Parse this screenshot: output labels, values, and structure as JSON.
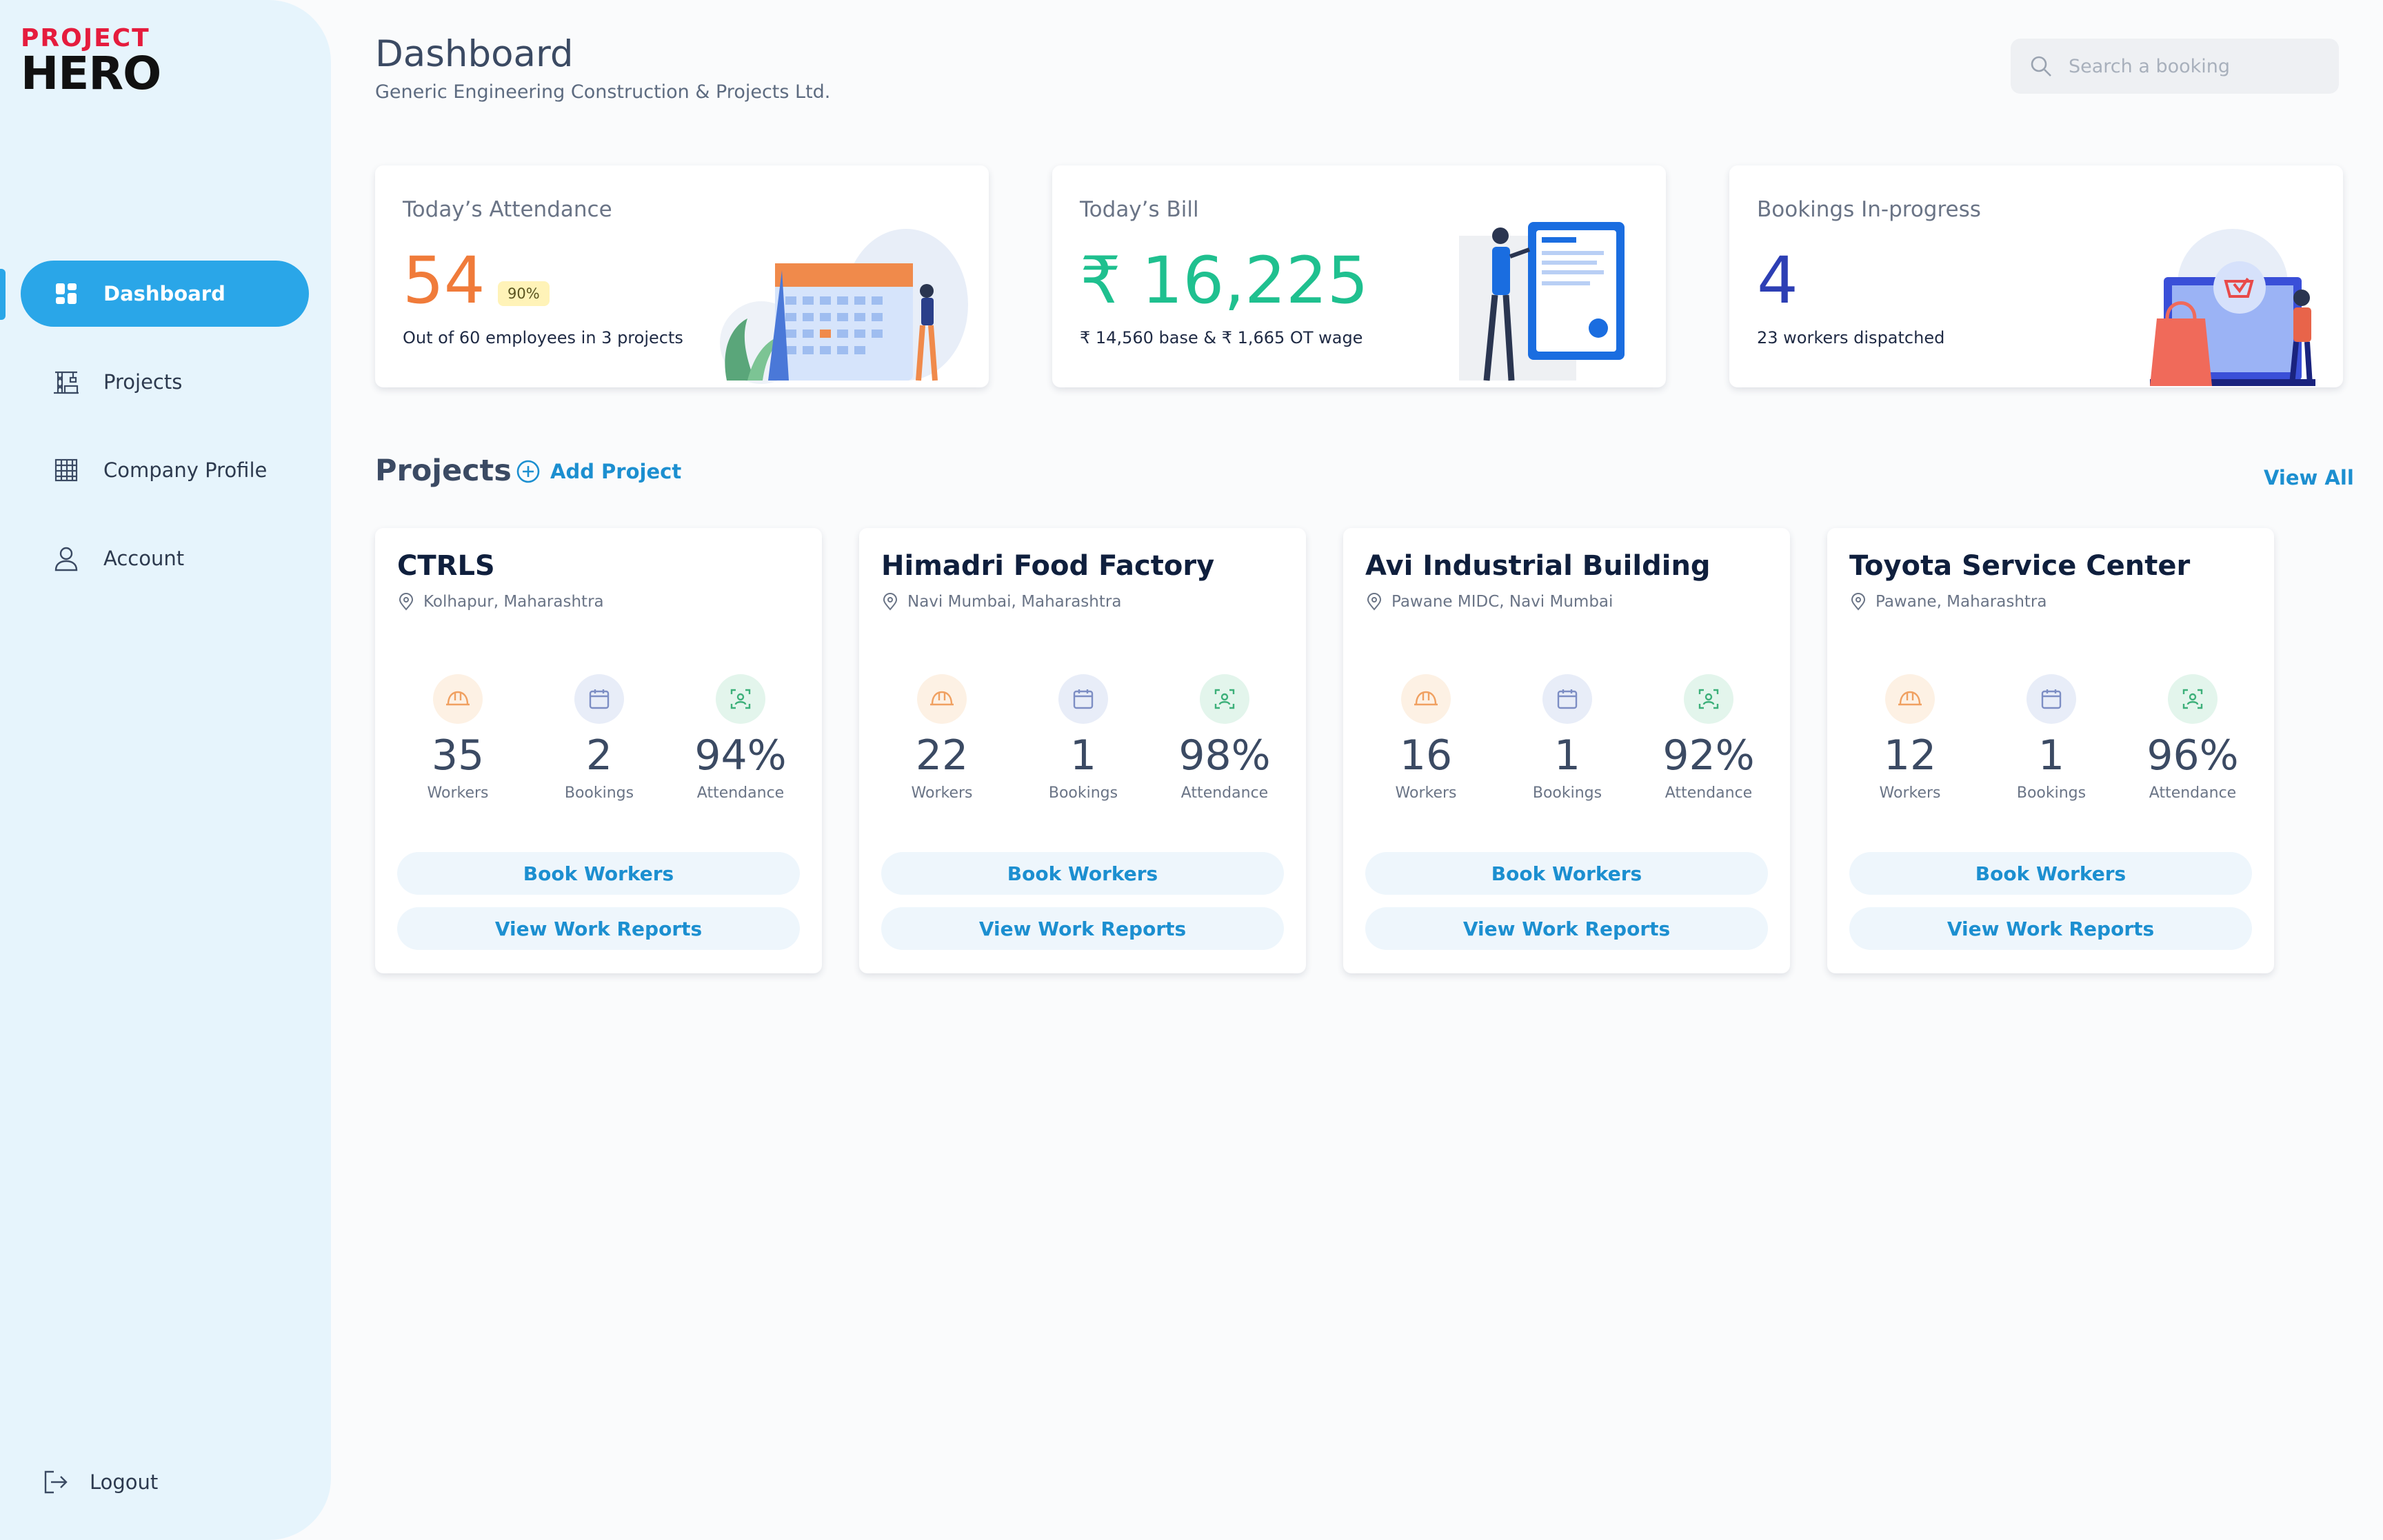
{
  "logo": {
    "line1": "PROJECT",
    "line2": "HERO"
  },
  "sidebar": {
    "items": [
      {
        "label": "Dashboard",
        "icon": "dashboard-grid-icon",
        "active": true
      },
      {
        "label": "Projects",
        "icon": "crane-icon",
        "active": false
      },
      {
        "label": "Company Profile",
        "icon": "building-icon",
        "active": false
      },
      {
        "label": "Account",
        "icon": "user-icon",
        "active": false
      }
    ],
    "logout": "Logout"
  },
  "header": {
    "title": "Dashboard",
    "subtitle": "Generic Engineering Construction & Projects Ltd.",
    "search_placeholder": "Search a booking"
  },
  "stats": [
    {
      "label": "Today’s Attendance",
      "value": "54",
      "badge": "90%",
      "caption": "Out of 60 employees in 3 projects",
      "color": "#f07b3a"
    },
    {
      "label": "Today’s Bill",
      "value": "₹ 16,225",
      "caption": "₹ 14,560 base & ₹ 1,665 OT wage",
      "color": "#1fc08f"
    },
    {
      "label": "Bookings In-progress",
      "value": "4",
      "caption": "23 workers dispatched",
      "color": "#2d3fb4"
    }
  ],
  "projects_section": {
    "title": "Projects",
    "add_label": "Add Project",
    "view_all": "View All"
  },
  "projects": [
    {
      "name": "CTRLS",
      "location": "Kolhapur, Maharashtra",
      "workers": "35",
      "bookings": "2",
      "attendance": "94%"
    },
    {
      "name": "Himadri Food Factory",
      "location": "Navi Mumbai, Maharashtra",
      "workers": "22",
      "bookings": "1",
      "attendance": "98%"
    },
    {
      "name": "Avi Industrial Building",
      "location": "Pawane MIDC, Navi Mumbai",
      "workers": "16",
      "bookings": "1",
      "attendance": "92%"
    },
    {
      "name": "Toyota Service Center",
      "location": "Pawane, Maharashtra",
      "workers": "12",
      "bookings": "1",
      "attendance": "96%"
    }
  ],
  "metric_labels": {
    "workers": "Workers",
    "bookings": "Bookings",
    "attendance": "Attendance"
  },
  "card_buttons": {
    "book": "Book Workers",
    "reports": "View Work Reports"
  },
  "colors": {
    "accent": "#2aa6e8",
    "link": "#1c8fd0",
    "sidebar_bg": "#e6f4fc"
  }
}
